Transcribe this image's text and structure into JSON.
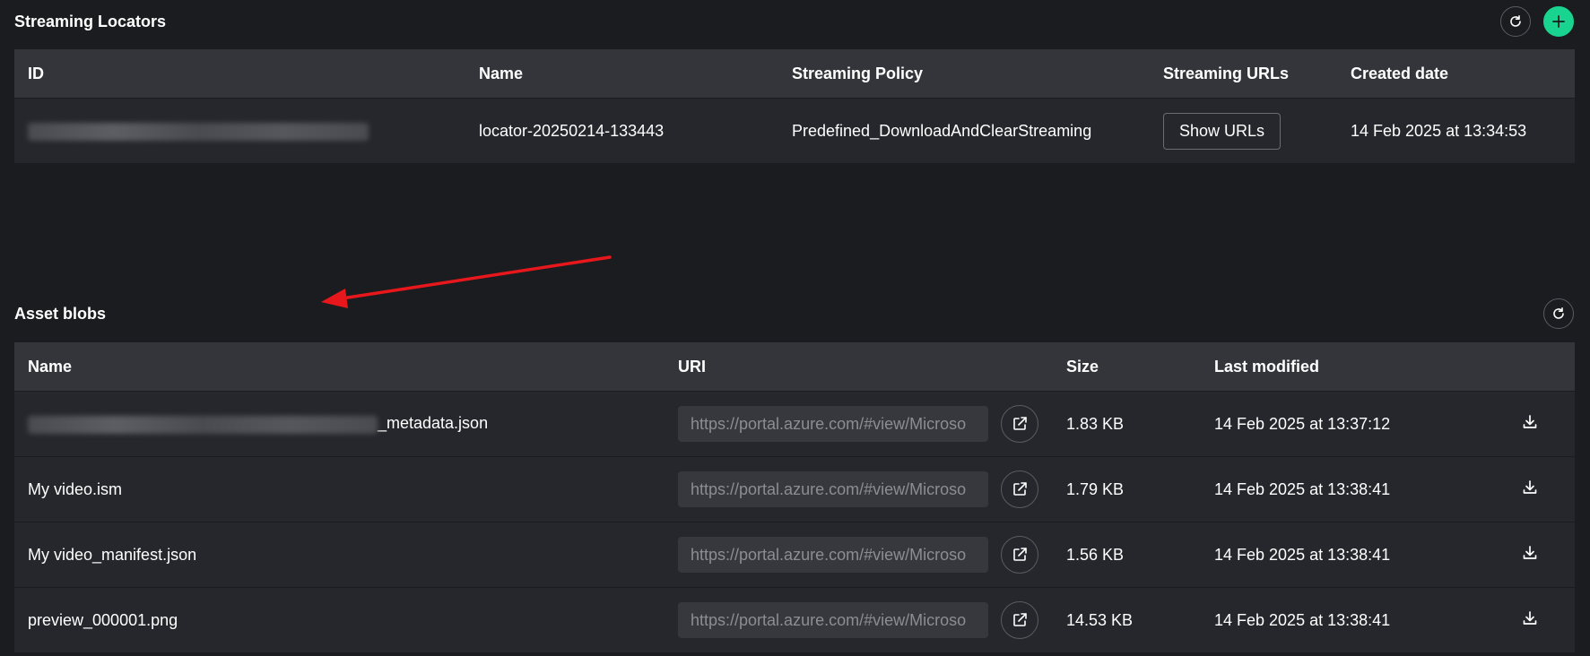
{
  "locators": {
    "title": "Streaming Locators",
    "refresh_icon": "refresh-icon",
    "add_icon": "plus-icon",
    "columns": [
      "ID",
      "Name",
      "Streaming Policy",
      "Streaming URLs",
      "Created date"
    ],
    "rows": [
      {
        "id": "",
        "name": "locator-20250214-133443",
        "policy": "Predefined_DownloadAndClearStreaming",
        "urls_button": "Show URLs",
        "created": "14 Feb 2025 at 13:34:53"
      }
    ]
  },
  "blobs": {
    "title": "Asset blobs",
    "refresh_icon": "refresh-icon",
    "columns": [
      "Name",
      "URI",
      "Size",
      "Last modified",
      ""
    ],
    "rows": [
      {
        "name": "_metadata.json",
        "uri": "https://portal.azure.com/#view/Microso",
        "size": "1.83 KB",
        "modified": "14 Feb 2025 at 13:37:12"
      },
      {
        "name": "My video.ism",
        "uri": "https://portal.azure.com/#view/Microso",
        "size": "1.79 KB",
        "modified": "14 Feb 2025 at 13:38:41"
      },
      {
        "name": "My video_manifest.json",
        "uri": "https://portal.azure.com/#view/Microso",
        "size": "1.56 KB",
        "modified": "14 Feb 2025 at 13:38:41"
      },
      {
        "name": "preview_000001.png",
        "uri": "https://portal.azure.com/#view/Microso",
        "size": "14.53 KB",
        "modified": "14 Feb 2025 at 13:38:41"
      }
    ]
  },
  "icons": {
    "external": "external-link-icon",
    "download": "download-icon"
  },
  "colors": {
    "background": "#1b1c20",
    "header_row": "#34353b",
    "body_row": "#26272c",
    "accent": "#19d48f",
    "annotation_arrow": "#e8171b"
  }
}
